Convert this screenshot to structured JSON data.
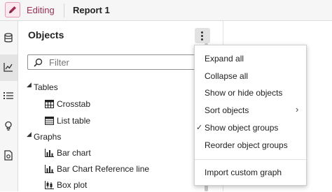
{
  "header": {
    "mode_label": "Editing",
    "report_title": "Report 1"
  },
  "rail": {
    "items": [
      {
        "icon": "database-icon",
        "active": false
      },
      {
        "icon": "line-chart-icon",
        "active": true
      },
      {
        "icon": "list-icon",
        "active": false
      },
      {
        "icon": "lightbulb-icon",
        "active": false
      },
      {
        "icon": "page-settings-icon",
        "active": false
      }
    ]
  },
  "objects_pane": {
    "title": "Objects",
    "filter": {
      "placeholder": "Filter",
      "value": ""
    },
    "groups": [
      {
        "label": "Tables",
        "expanded": true,
        "items": [
          {
            "label": "Crosstab",
            "icon": "crosstab-icon"
          },
          {
            "label": "List table",
            "icon": "list-table-icon"
          }
        ]
      },
      {
        "label": "Graphs",
        "expanded": true,
        "items": [
          {
            "label": "Bar chart",
            "icon": "bar-chart-icon"
          },
          {
            "label": "Bar Chart Reference line",
            "icon": "bar-chart-reference-icon"
          },
          {
            "label": "Box plot",
            "icon": "box-plot-icon"
          }
        ]
      }
    ]
  },
  "menu": {
    "items": [
      {
        "label": "Expand all"
      },
      {
        "label": "Collapse all"
      },
      {
        "label": "Show or hide objects"
      },
      {
        "label": "Sort objects",
        "submenu": "›"
      },
      {
        "label": "Show object groups",
        "check": "✓"
      },
      {
        "label": "Reorder object groups"
      },
      {
        "label": "Import custom graph"
      }
    ]
  },
  "colors": {
    "accent": "#9b2e55",
    "accent_bg": "#fde8ef",
    "rail_bg": "#f6f6f6",
    "rail_active": "#e4e4e4"
  }
}
